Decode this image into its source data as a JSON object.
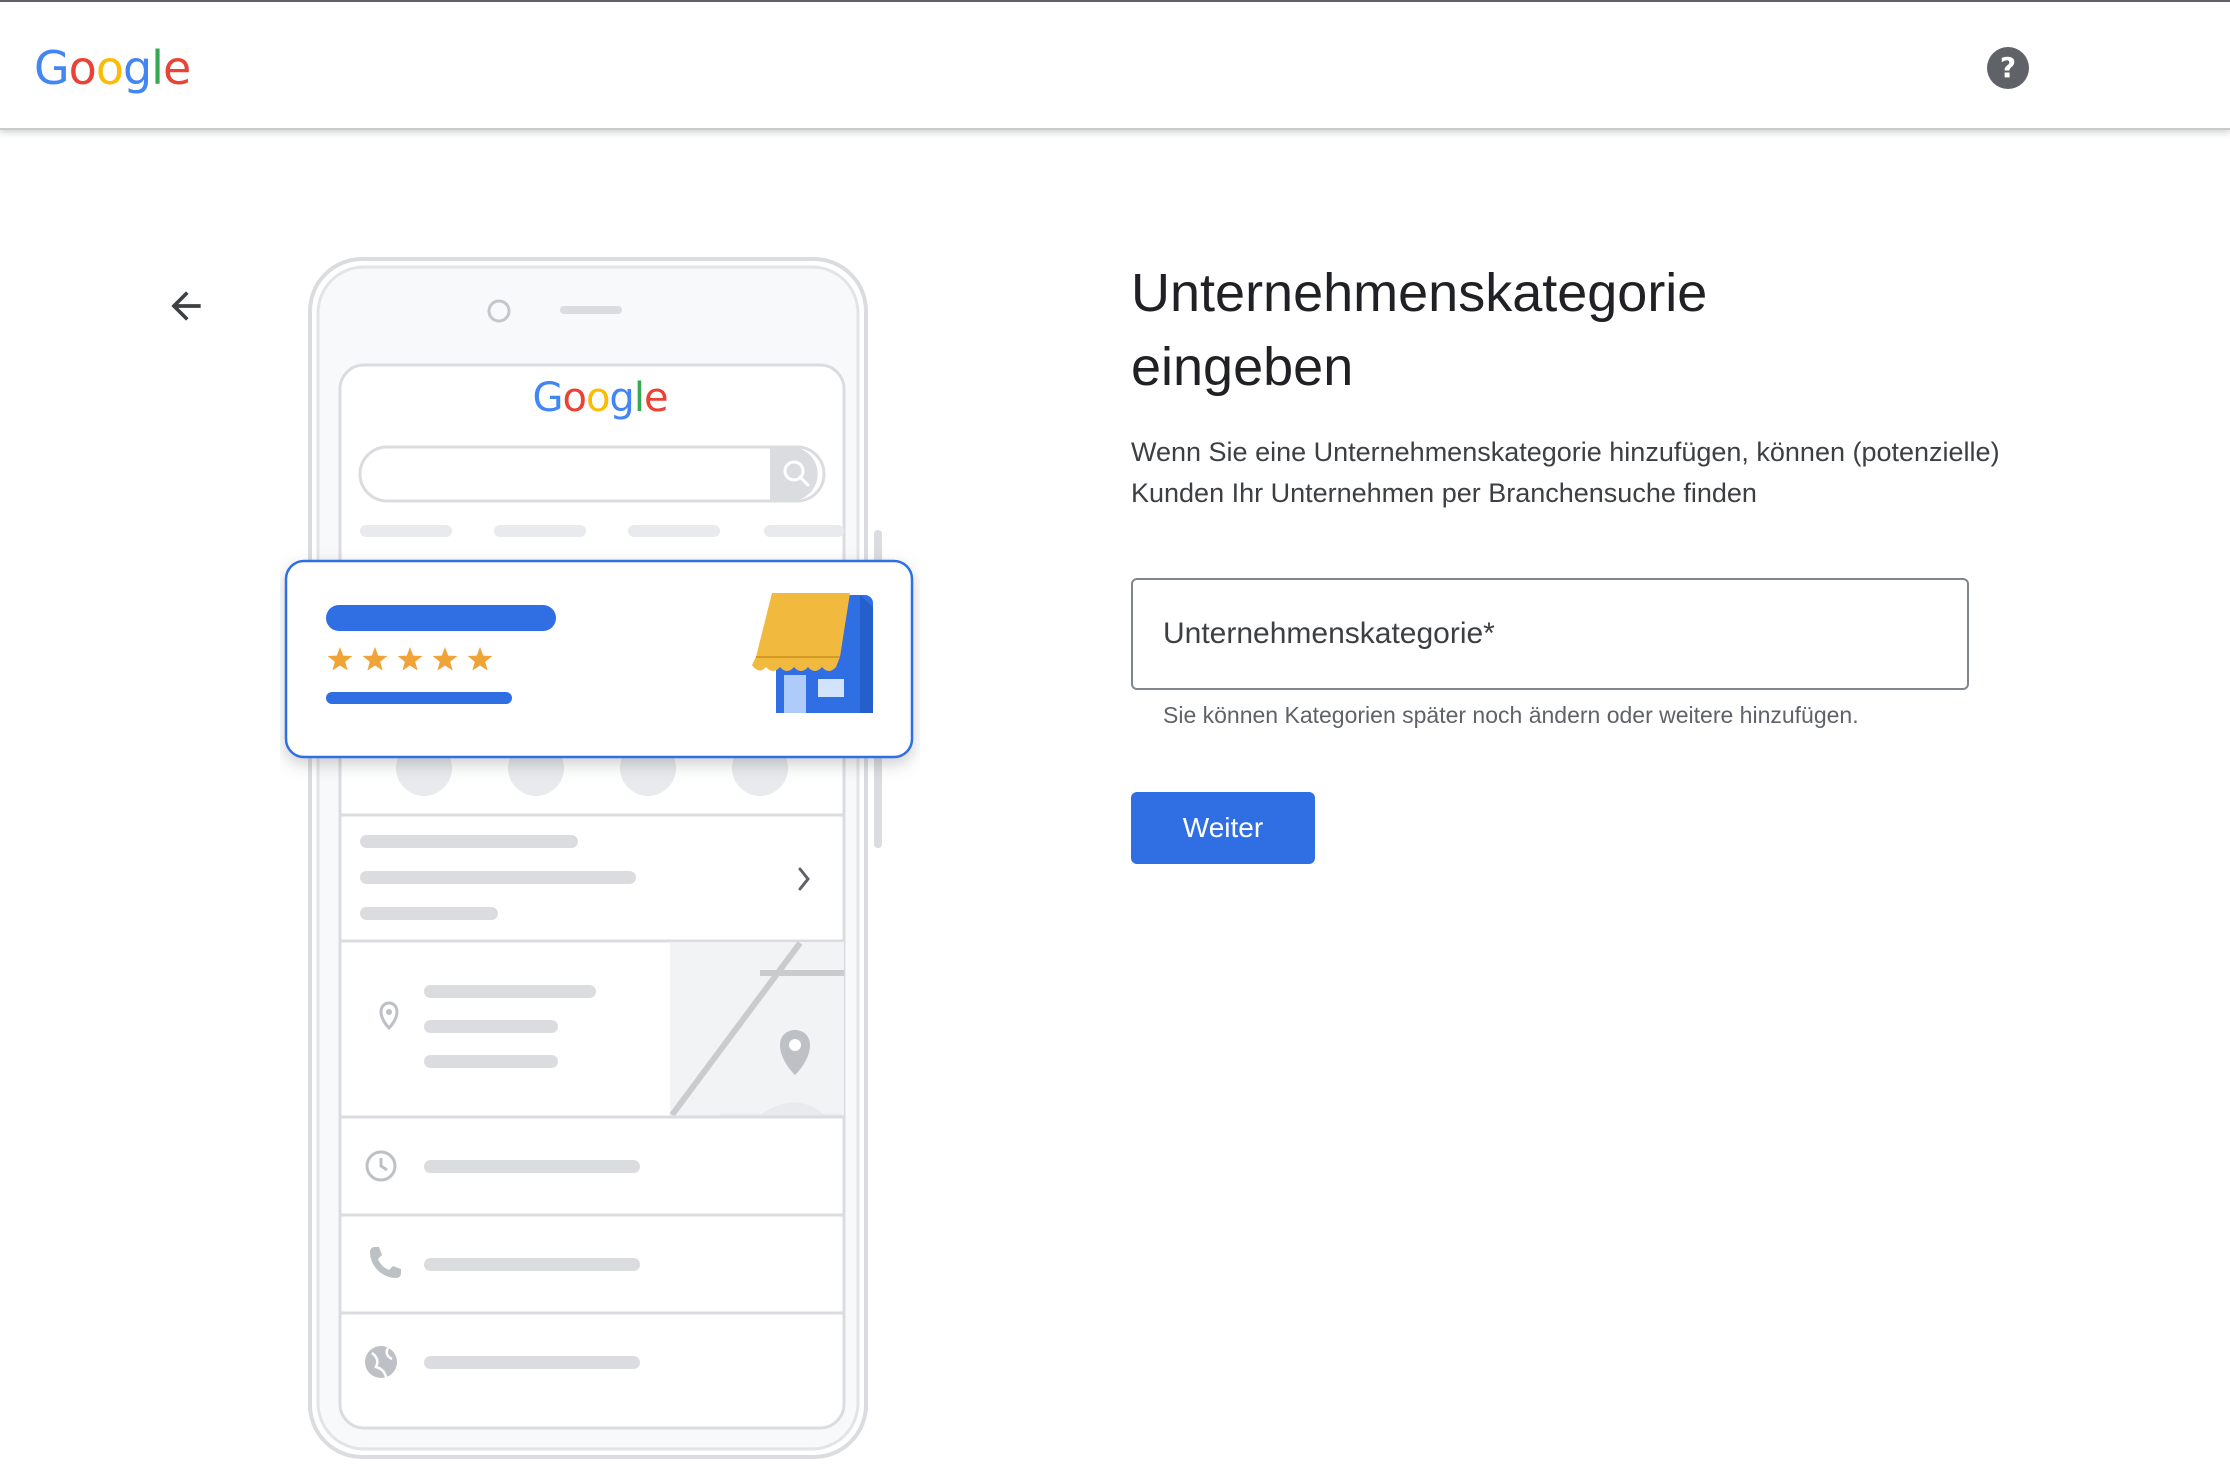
{
  "header": {
    "logo_letters": [
      "G",
      "o",
      "o",
      "g",
      "l",
      "e"
    ],
    "help_icon": "help-circle-icon",
    "help_label": "?"
  },
  "navigation": {
    "back_icon": "arrow-back-icon"
  },
  "illustration": {
    "logo_letters": [
      "G",
      "o",
      "o",
      "g",
      "l",
      "e"
    ],
    "rating_stars": 5,
    "icons": [
      "search-icon",
      "storefront-icon",
      "phone-icon",
      "directions-icon",
      "bookmark-icon",
      "globe-icon",
      "chevron-right-icon",
      "location-pin-icon",
      "map-pin-icon",
      "clock-icon",
      "phone-icon",
      "globe-icon"
    ]
  },
  "main": {
    "title": "Unternehmenskategorie eingeben",
    "description": "Wenn Sie eine Unternehmenskategorie hinzufügen, können (potenzielle) Kunden Ihr Unternehmen per Branchensuche finden",
    "category_field": {
      "placeholder": "Unternehmenskategorie*",
      "value": ""
    },
    "hint": "Sie können Kategorien später noch ändern oder weitere hinzufügen.",
    "next_button": "Weiter"
  },
  "colors": {
    "google_blue": "#4285F4",
    "google_red": "#EA4335",
    "google_yellow": "#FBBC05",
    "google_green": "#34A853",
    "button_blue": "#2f6fe3",
    "star_color": "#f0a336",
    "awning_yellow": "#f2b93f"
  }
}
